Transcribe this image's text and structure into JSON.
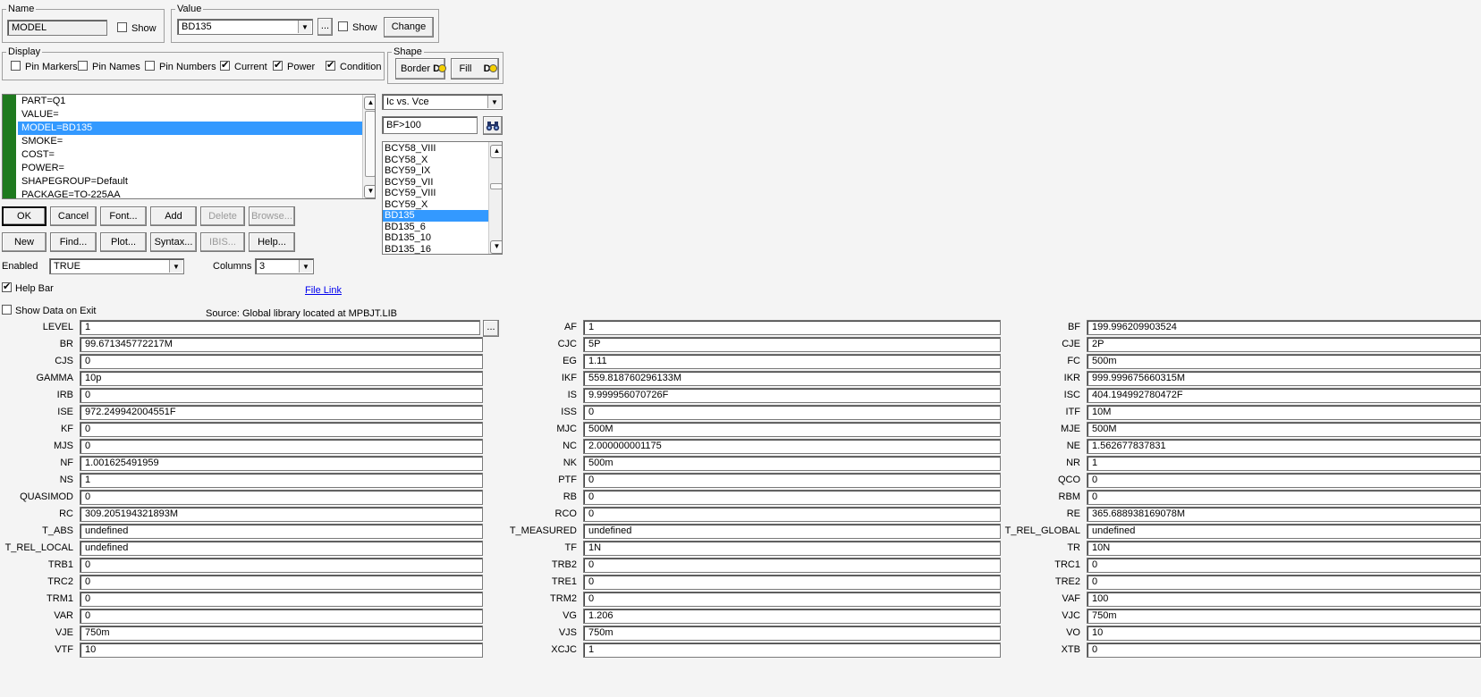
{
  "name": {
    "legend": "Name",
    "value": "MODEL",
    "show_label": "Show",
    "show_checked": false
  },
  "value": {
    "legend": "Value",
    "value": "BD135",
    "browse_label": "...",
    "show_label": "Show",
    "show_checked": false,
    "change_label": "Change"
  },
  "display": {
    "legend": "Display",
    "items": [
      {
        "label": "Pin Markers",
        "checked": false
      },
      {
        "label": "Pin Names",
        "checked": false
      },
      {
        "label": "Pin Numbers",
        "checked": false
      },
      {
        "label": "Current",
        "checked": true
      },
      {
        "label": "Power",
        "checked": true
      },
      {
        "label": "Condition",
        "checked": true
      }
    ]
  },
  "shape": {
    "legend": "Shape",
    "border_label": "Border",
    "fill_label": "Fill",
    "d_glyph": "D"
  },
  "attributes": [
    "PART=Q1",
    "VALUE=",
    "MODEL=BD135",
    "SMOKE=",
    "COST=",
    "POWER=",
    "SHAPEGROUP=Default",
    "PACKAGE=TO-225AA"
  ],
  "attributes_selected": 2,
  "plot_select": "Ic vs. Vce",
  "filter_value": "BF>100",
  "models": [
    "BCY58_VIII",
    "BCY58_X",
    "BCY59_IX",
    "BCY59_VII",
    "BCY59_VIII",
    "BCY59_X",
    "BD135",
    "BD135_6",
    "BD135_10",
    "BD135_16"
  ],
  "models_selected": 6,
  "buttons_row1": [
    {
      "label": "OK",
      "enabled": true
    },
    {
      "label": "Cancel",
      "enabled": true
    },
    {
      "label": "Font...",
      "enabled": true
    },
    {
      "label": "Add",
      "enabled": true
    },
    {
      "label": "Delete",
      "enabled": false
    },
    {
      "label": "Browse...",
      "enabled": false
    }
  ],
  "buttons_row2": [
    {
      "label": "New",
      "enabled": true
    },
    {
      "label": "Find...",
      "enabled": true
    },
    {
      "label": "Plot...",
      "enabled": true
    },
    {
      "label": "Syntax...",
      "enabled": true
    },
    {
      "label": "IBIS...",
      "enabled": false
    },
    {
      "label": "Help...",
      "enabled": true
    }
  ],
  "enabled_label": "Enabled",
  "enabled_value": "TRUE",
  "columns_label": "Columns",
  "columns_value": "3",
  "help_bar": {
    "label": "Help Bar",
    "checked": true
  },
  "file_link": "File Link",
  "show_data": {
    "label": "Show Data on Exit",
    "checked": false
  },
  "source_text": "Source: Global library located at MPBJT.LIB",
  "level_browse": "...",
  "params": [
    [
      [
        "LEVEL",
        "1"
      ],
      [
        "AF",
        "1"
      ],
      [
        "BF",
        "199.996209903524"
      ]
    ],
    [
      [
        "BR",
        "99.671345772217M"
      ],
      [
        "CJC",
        "5P"
      ],
      [
        "CJE",
        "2P"
      ]
    ],
    [
      [
        "CJS",
        "0"
      ],
      [
        "EG",
        "1.11"
      ],
      [
        "FC",
        "500m"
      ]
    ],
    [
      [
        "GAMMA",
        "10p"
      ],
      [
        "IKF",
        "559.818760296133M"
      ],
      [
        "IKR",
        "999.999675660315M"
      ]
    ],
    [
      [
        "IRB",
        "0"
      ],
      [
        "IS",
        "9.999956070726F"
      ],
      [
        "ISC",
        "404.194992780472F"
      ]
    ],
    [
      [
        "ISE",
        "972.249942004551F"
      ],
      [
        "ISS",
        "0"
      ],
      [
        "ITF",
        "10M"
      ]
    ],
    [
      [
        "KF",
        "0"
      ],
      [
        "MJC",
        "500M"
      ],
      [
        "MJE",
        "500M"
      ]
    ],
    [
      [
        "MJS",
        "0"
      ],
      [
        "NC",
        "2.000000001175"
      ],
      [
        "NE",
        "1.562677837831"
      ]
    ],
    [
      [
        "NF",
        "1.001625491959"
      ],
      [
        "NK",
        "500m"
      ],
      [
        "NR",
        "1"
      ]
    ],
    [
      [
        "NS",
        "1"
      ],
      [
        "PTF",
        "0"
      ],
      [
        "QCO",
        "0"
      ]
    ],
    [
      [
        "QUASIMOD",
        "0"
      ],
      [
        "RB",
        "0"
      ],
      [
        "RBM",
        "0"
      ]
    ],
    [
      [
        "RC",
        "309.205194321893M"
      ],
      [
        "RCO",
        "0"
      ],
      [
        "RE",
        "365.688938169078M"
      ]
    ],
    [
      [
        "T_ABS",
        "undefined"
      ],
      [
        "T_MEASURED",
        "undefined"
      ],
      [
        "T_REL_GLOBAL",
        "undefined"
      ]
    ],
    [
      [
        "T_REL_LOCAL",
        "undefined"
      ],
      [
        "TF",
        "1N"
      ],
      [
        "TR",
        "10N"
      ]
    ],
    [
      [
        "TRB1",
        "0"
      ],
      [
        "TRB2",
        "0"
      ],
      [
        "TRC1",
        "0"
      ]
    ],
    [
      [
        "TRC2",
        "0"
      ],
      [
        "TRE1",
        "0"
      ],
      [
        "TRE2",
        "0"
      ]
    ],
    [
      [
        "TRM1",
        "0"
      ],
      [
        "TRM2",
        "0"
      ],
      [
        "VAF",
        "100"
      ]
    ],
    [
      [
        "VAR",
        "0"
      ],
      [
        "VG",
        "1.206"
      ],
      [
        "VJC",
        "750m"
      ]
    ],
    [
      [
        "VJE",
        "750m"
      ],
      [
        "VJS",
        "750m"
      ],
      [
        "VO",
        "10"
      ]
    ],
    [
      [
        "VTF",
        "10"
      ],
      [
        "XCJC",
        "1"
      ],
      [
        "XTB",
        "0"
      ]
    ]
  ]
}
